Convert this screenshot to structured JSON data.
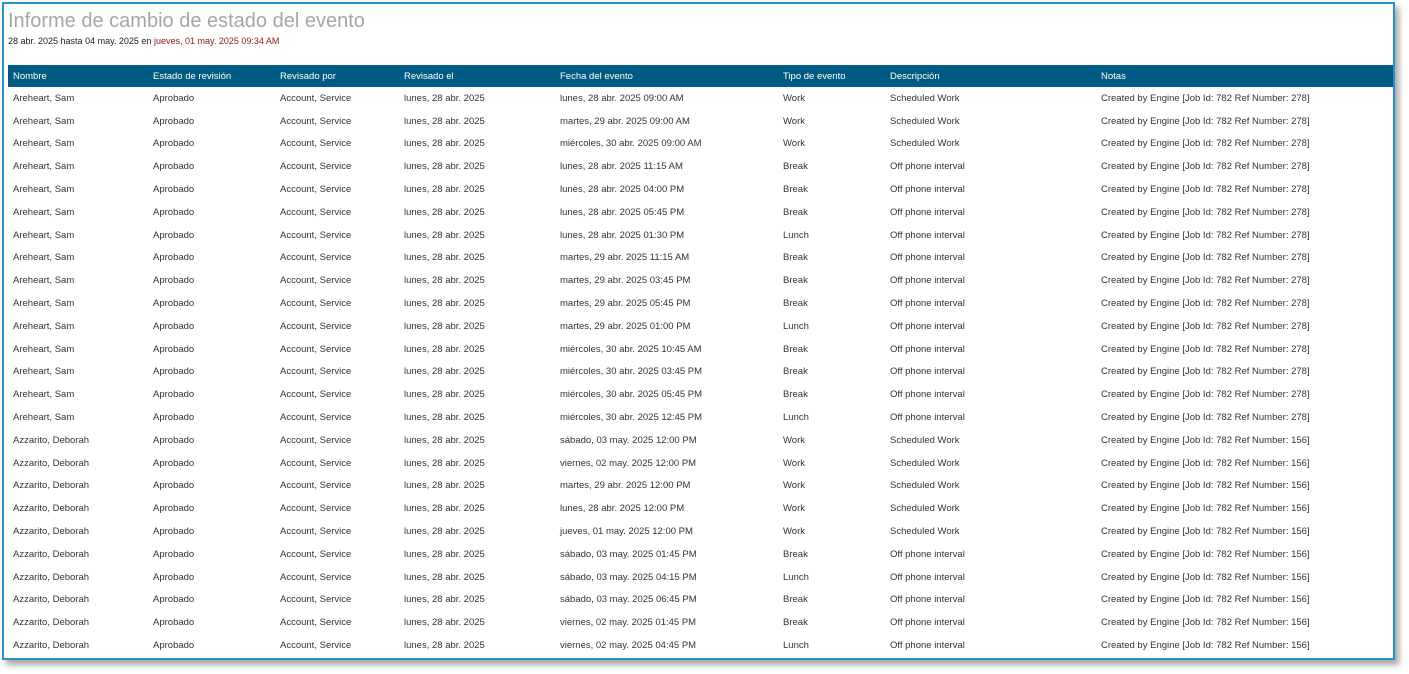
{
  "report": {
    "title": "Informe de cambio de estado del evento",
    "range": "28 abr. 2025 hasta 04 may. 2025 en ",
    "generated": "jueves, 01 may. 2025 09:34 AM"
  },
  "colors": {
    "header_bg": "#005b84",
    "frame_border": "#2a8fc9",
    "title_text": "#a6a6a6",
    "generated_text": "#8b1a1a"
  },
  "table": {
    "columns": [
      "Nombre",
      "Estado de revisión",
      "Revisado por",
      "Revisado el",
      "Fecha del evento",
      "Tipo de evento",
      "Descripción",
      "Notas"
    ],
    "rows": [
      [
        "Areheart, Sam",
        "Aprobado",
        "Account, Service",
        "lunes, 28 abr. 2025",
        "lunes, 28 abr. 2025 09:00 AM",
        "Work",
        "Scheduled Work",
        "Created by Engine [Job Id: 782 Ref Number: 278]"
      ],
      [
        "Areheart, Sam",
        "Aprobado",
        "Account, Service",
        "lunes, 28 abr. 2025",
        "martes, 29 abr. 2025 09:00 AM",
        "Work",
        "Scheduled Work",
        "Created by Engine [Job Id: 782 Ref Number: 278]"
      ],
      [
        "Areheart, Sam",
        "Aprobado",
        "Account, Service",
        "lunes, 28 abr. 2025",
        "miércoles, 30 abr. 2025 09:00 AM",
        "Work",
        "Scheduled Work",
        "Created by Engine [Job Id: 782 Ref Number: 278]"
      ],
      [
        "Areheart, Sam",
        "Aprobado",
        "Account, Service",
        "lunes, 28 abr. 2025",
        "lunes, 28 abr. 2025 11:15 AM",
        "Break",
        "Off phone interval",
        "Created by Engine [Job Id: 782 Ref Number: 278]"
      ],
      [
        "Areheart, Sam",
        "Aprobado",
        "Account, Service",
        "lunes, 28 abr. 2025",
        "lunes, 28 abr. 2025 04:00 PM",
        "Break",
        "Off phone interval",
        "Created by Engine [Job Id: 782 Ref Number: 278]"
      ],
      [
        "Areheart, Sam",
        "Aprobado",
        "Account, Service",
        "lunes, 28 abr. 2025",
        "lunes, 28 abr. 2025 05:45 PM",
        "Break",
        "Off phone interval",
        "Created by Engine [Job Id: 782 Ref Number: 278]"
      ],
      [
        "Areheart, Sam",
        "Aprobado",
        "Account, Service",
        "lunes, 28 abr. 2025",
        "lunes, 28 abr. 2025 01:30 PM",
        "Lunch",
        "Off phone interval",
        "Created by Engine [Job Id: 782 Ref Number: 278]"
      ],
      [
        "Areheart, Sam",
        "Aprobado",
        "Account, Service",
        "lunes, 28 abr. 2025",
        "martes, 29 abr. 2025 11:15 AM",
        "Break",
        "Off phone interval",
        "Created by Engine [Job Id: 782 Ref Number: 278]"
      ],
      [
        "Areheart, Sam",
        "Aprobado",
        "Account, Service",
        "lunes, 28 abr. 2025",
        "martes, 29 abr. 2025 03:45 PM",
        "Break",
        "Off phone interval",
        "Created by Engine [Job Id: 782 Ref Number: 278]"
      ],
      [
        "Areheart, Sam",
        "Aprobado",
        "Account, Service",
        "lunes, 28 abr. 2025",
        "martes, 29 abr. 2025 05:45 PM",
        "Break",
        "Off phone interval",
        "Created by Engine [Job Id: 782 Ref Number: 278]"
      ],
      [
        "Areheart, Sam",
        "Aprobado",
        "Account, Service",
        "lunes, 28 abr. 2025",
        "martes, 29 abr. 2025 01:00 PM",
        "Lunch",
        "Off phone interval",
        "Created by Engine [Job Id: 782 Ref Number: 278]"
      ],
      [
        "Areheart, Sam",
        "Aprobado",
        "Account, Service",
        "lunes, 28 abr. 2025",
        "miércoles, 30 abr. 2025 10:45 AM",
        "Break",
        "Off phone interval",
        "Created by Engine [Job Id: 782 Ref Number: 278]"
      ],
      [
        "Areheart, Sam",
        "Aprobado",
        "Account, Service",
        "lunes, 28 abr. 2025",
        "miércoles, 30 abr. 2025 03:45 PM",
        "Break",
        "Off phone interval",
        "Created by Engine [Job Id: 782 Ref Number: 278]"
      ],
      [
        "Areheart, Sam",
        "Aprobado",
        "Account, Service",
        "lunes, 28 abr. 2025",
        "miércoles, 30 abr. 2025 05:45 PM",
        "Break",
        "Off phone interval",
        "Created by Engine [Job Id: 782 Ref Number: 278]"
      ],
      [
        "Areheart, Sam",
        "Aprobado",
        "Account, Service",
        "lunes, 28 abr. 2025",
        "miércoles, 30 abr. 2025 12:45 PM",
        "Lunch",
        "Off phone interval",
        "Created by Engine [Job Id: 782 Ref Number: 278]"
      ],
      [
        "Azzarito, Deborah",
        "Aprobado",
        "Account, Service",
        "lunes, 28 abr. 2025",
        "sábado, 03 may. 2025 12:00 PM",
        "Work",
        "Scheduled Work",
        "Created by Engine [Job Id: 782 Ref Number: 156]"
      ],
      [
        "Azzarito, Deborah",
        "Aprobado",
        "Account, Service",
        "lunes, 28 abr. 2025",
        "viernes, 02 may. 2025 12:00 PM",
        "Work",
        "Scheduled Work",
        "Created by Engine [Job Id: 782 Ref Number: 156]"
      ],
      [
        "Azzarito, Deborah",
        "Aprobado",
        "Account, Service",
        "lunes, 28 abr. 2025",
        "martes, 29 abr. 2025 12:00 PM",
        "Work",
        "Scheduled Work",
        "Created by Engine [Job Id: 782 Ref Number: 156]"
      ],
      [
        "Azzarito, Deborah",
        "Aprobado",
        "Account, Service",
        "lunes, 28 abr. 2025",
        "lunes, 28 abr. 2025 12:00 PM",
        "Work",
        "Scheduled Work",
        "Created by Engine [Job Id: 782 Ref Number: 156]"
      ],
      [
        "Azzarito, Deborah",
        "Aprobado",
        "Account, Service",
        "lunes, 28 abr. 2025",
        "jueves, 01 may. 2025 12:00 PM",
        "Work",
        "Scheduled Work",
        "Created by Engine [Job Id: 782 Ref Number: 156]"
      ],
      [
        "Azzarito, Deborah",
        "Aprobado",
        "Account, Service",
        "lunes, 28 abr. 2025",
        "sábado, 03 may. 2025 01:45 PM",
        "Break",
        "Off phone interval",
        "Created by Engine [Job Id: 782 Ref Number: 156]"
      ],
      [
        "Azzarito, Deborah",
        "Aprobado",
        "Account, Service",
        "lunes, 28 abr. 2025",
        "sábado, 03 may. 2025 04:15 PM",
        "Lunch",
        "Off phone interval",
        "Created by Engine [Job Id: 782 Ref Number: 156]"
      ],
      [
        "Azzarito, Deborah",
        "Aprobado",
        "Account, Service",
        "lunes, 28 abr. 2025",
        "sábado, 03 may. 2025 06:45 PM",
        "Break",
        "Off phone interval",
        "Created by Engine [Job Id: 782 Ref Number: 156]"
      ],
      [
        "Azzarito, Deborah",
        "Aprobado",
        "Account, Service",
        "lunes, 28 abr. 2025",
        "viernes, 02 may. 2025 01:45 PM",
        "Break",
        "Off phone interval",
        "Created by Engine [Job Id: 782 Ref Number: 156]"
      ],
      [
        "Azzarito, Deborah",
        "Aprobado",
        "Account, Service",
        "lunes, 28 abr. 2025",
        "viernes, 02 may. 2025 04:45 PM",
        "Lunch",
        "Off phone interval",
        "Created by Engine [Job Id: 782 Ref Number: 156]"
      ]
    ]
  }
}
